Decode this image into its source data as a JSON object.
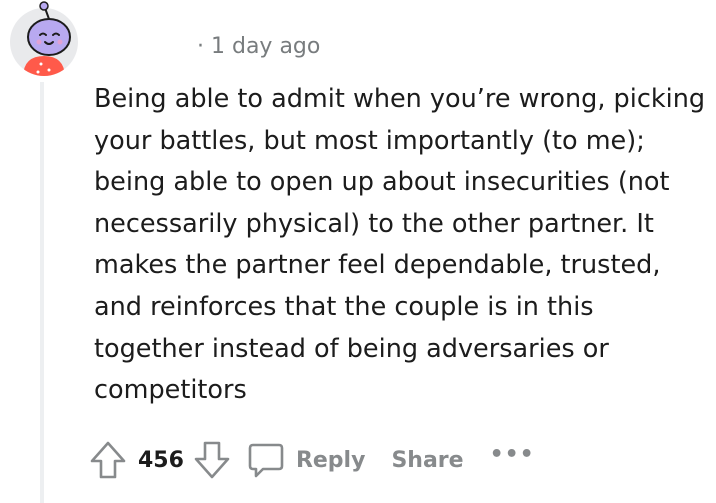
{
  "comment": {
    "meta_separator": "·",
    "timestamp": "1 day ago",
    "body": "Being able to admit when you’re wrong, picking your battles, but most importantly (to me); being able to open up about insecurities (not necessarily physical) to the other partner. It makes the partner feel dependable, trusted, and reinforces that the couple is in this together instead of being adversaries or competitors"
  },
  "actions": {
    "upvote_icon": "arrow-up-icon",
    "vote_count": "456",
    "downvote_icon": "arrow-down-icon",
    "reply_icon": "speech-bubble-icon",
    "reply_label": "Reply",
    "share_label": "Share",
    "more_label": "•••"
  },
  "colors": {
    "text": "#1c1c1c",
    "meta": "#787c7e",
    "action": "#878a8c",
    "thread_line": "#edeff1",
    "avatar_face": "#b8a9f0",
    "avatar_shirt": "#ff5a4a"
  }
}
